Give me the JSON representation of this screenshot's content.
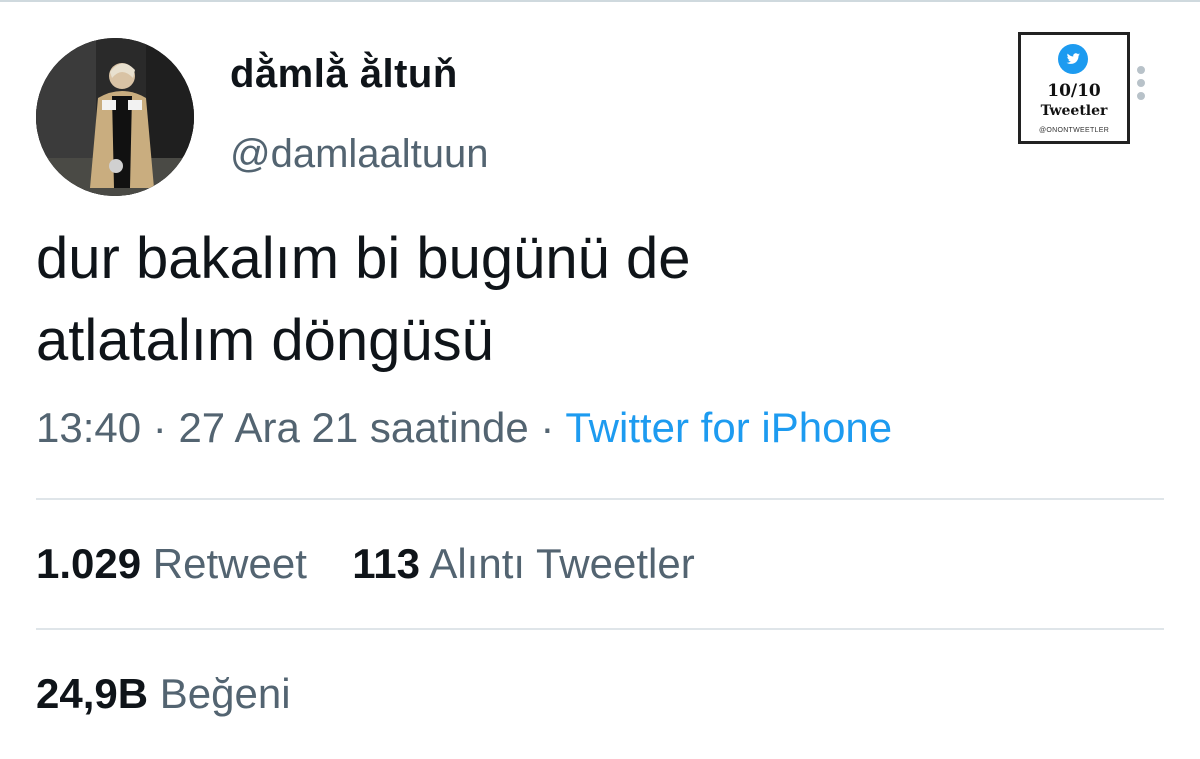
{
  "tweet": {
    "display_name": "dằmlằ ằltuň",
    "handle": "@damlaaltuun",
    "text_line1": "dur bakalım bi bugünü de",
    "text_line2": "atlatalım döngüsü",
    "time": "13:40",
    "separator": "·",
    "date": "27 Ara 21 saatinde",
    "source": "Twitter for iPhone"
  },
  "badge": {
    "icon": "twitter-bird-icon",
    "score": "10/10",
    "label": "Tweetler",
    "handle": "@ONONTWEETLER"
  },
  "stats": {
    "retweets_count": "1.029",
    "retweets_label": "Retweet",
    "quotes_count": "113",
    "quotes_label": "Alıntı Tweetler",
    "likes_count": "24,9B",
    "likes_label": "Beğeni"
  },
  "colors": {
    "link": "#1d9bf0",
    "muted_text": "#536471",
    "primary_text": "#0f1419",
    "divider": "#dfe5e9"
  }
}
